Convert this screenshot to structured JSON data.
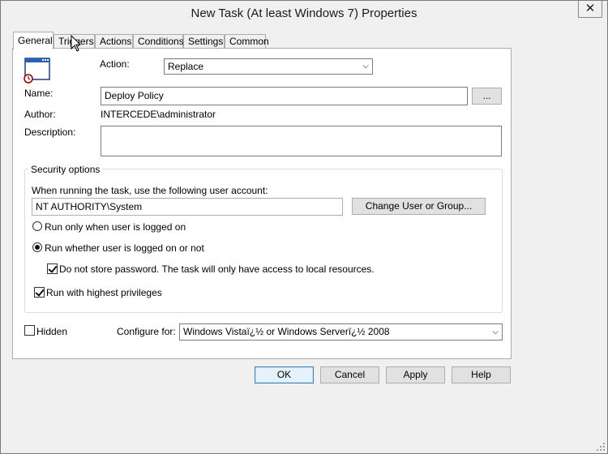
{
  "window": {
    "title": "New Task (At least Windows 7) Properties",
    "close_symbol": "✕"
  },
  "tabs": [
    {
      "label": "General",
      "active": true
    },
    {
      "label": "Triggers",
      "active": false
    },
    {
      "label": "Actions",
      "active": false
    },
    {
      "label": "Conditions",
      "active": false
    },
    {
      "label": "Settings",
      "active": false
    },
    {
      "label": "Common",
      "active": false
    }
  ],
  "general": {
    "action_label": "Action:",
    "action_value": "Replace",
    "name_label": "Name:",
    "name_value": "Deploy Policy",
    "browse_label": "...",
    "author_label": "Author:",
    "author_value": "INTERCEDE\\administrator",
    "description_label": "Description:",
    "description_value": ""
  },
  "security": {
    "group_title": "Security options",
    "account_prompt": "When running the task, use the following user account:",
    "account_value": "NT AUTHORITY\\System",
    "change_user_label": "Change User or Group...",
    "radio_logged_on": {
      "label": "Run only when user is logged on",
      "selected": false
    },
    "radio_whether": {
      "label": "Run whether user is logged on or not",
      "selected": true
    },
    "no_store_password": {
      "label": "Do not store password. The task will only have access to local resources.",
      "checked": true
    },
    "highest_privileges": {
      "label": "Run with highest privileges",
      "checked": true
    }
  },
  "footer": {
    "hidden": {
      "label": "Hidden",
      "checked": false
    },
    "configure_label": "Configure for:",
    "configure_value": "Windows Vistaï¿½ or Windows Serverï¿½ 2008"
  },
  "buttons": {
    "ok": "OK",
    "cancel": "Cancel",
    "apply": "Apply",
    "help": "Help"
  }
}
